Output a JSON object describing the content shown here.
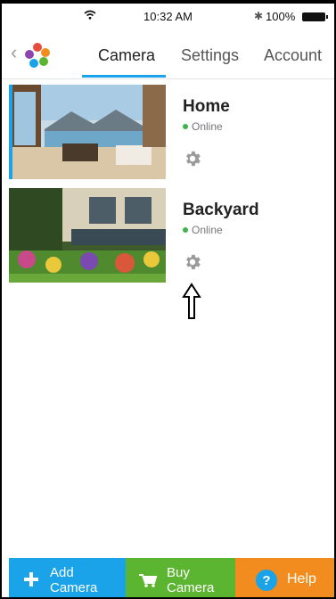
{
  "status_bar": {
    "time": "10:32 AM",
    "battery": "100%",
    "icons": [
      "wifi-icon",
      "bluetooth-icon",
      "battery-icon"
    ]
  },
  "header": {
    "tabs": [
      {
        "label": "Camera",
        "active": true
      },
      {
        "label": "Settings",
        "active": false
      },
      {
        "label": "Account",
        "active": false
      }
    ],
    "back_icon": "chevron-left-icon",
    "logo_icon": "app-logo-icon"
  },
  "cameras": [
    {
      "name": "Home",
      "status": "Online",
      "settings_icon": "gear-icon"
    },
    {
      "name": "Backyard",
      "status": "Online",
      "settings_icon": "gear-icon"
    }
  ],
  "bottom_bar": {
    "add_camera": {
      "line1": "Add",
      "line2": "Camera",
      "icon": "plus-icon"
    },
    "buy_camera": {
      "line1": "Buy",
      "line2": "Camera",
      "icon": "cart-icon"
    },
    "help": {
      "label": "Help",
      "icon": "help-icon"
    }
  },
  "colors": {
    "accent_blue": "#1aa3e8",
    "online_green": "#3bb54a",
    "buy_green": "#5cb531",
    "help_orange": "#f28c1e"
  }
}
